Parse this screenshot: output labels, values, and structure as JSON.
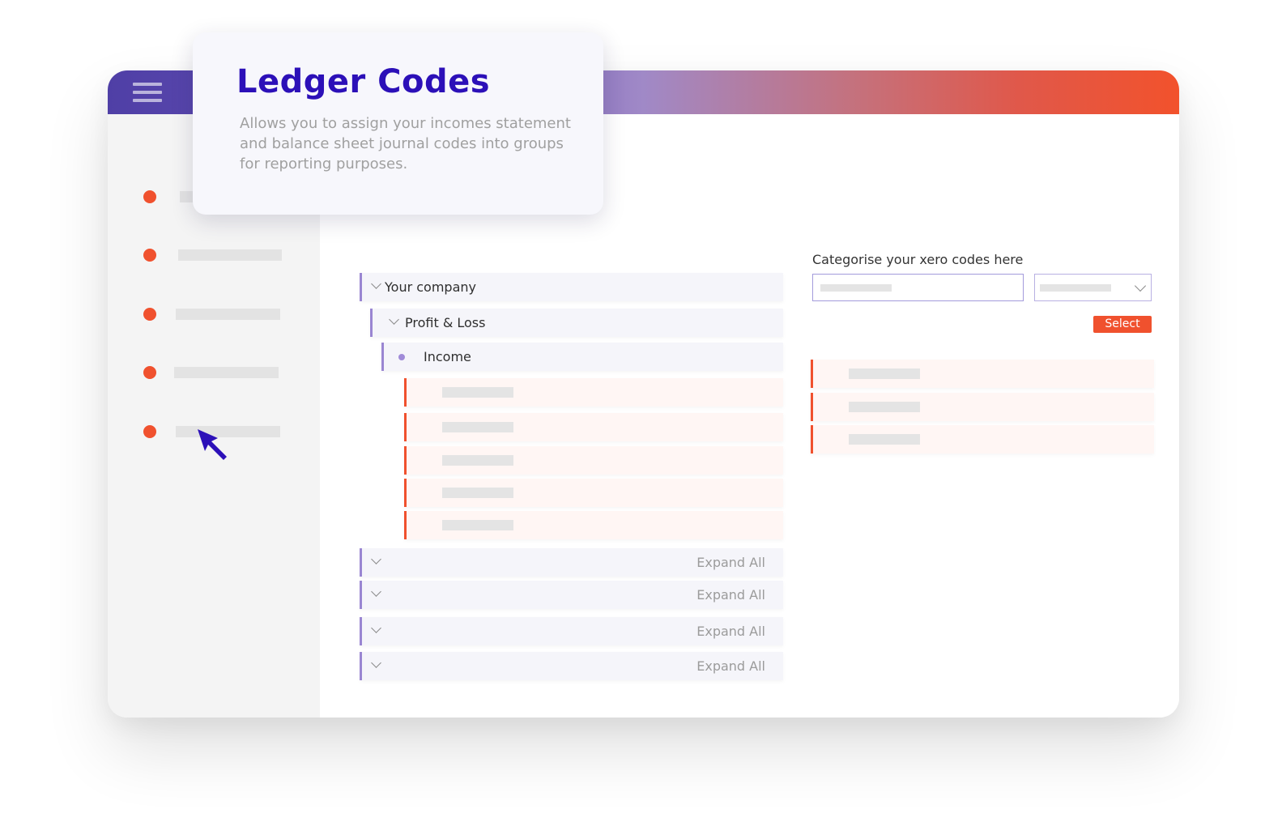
{
  "popover": {
    "title": "Ledger Codes",
    "description": "Allows you to assign your incomes statement and balance sheet journal codes into groups for reporting purposes."
  },
  "tree": {
    "root_label": "Your company",
    "child_label": "Profit & Loss",
    "leaf_label": "Income",
    "expand_all_label": "Expand All"
  },
  "categorise": {
    "title": "Categorise your xero codes here",
    "search_value": "",
    "select_button": "Select"
  },
  "icons": {
    "menu": "hamburger-menu-icon",
    "chevron": "chevron-down-icon",
    "cursor": "mouse-pointer-icon"
  },
  "colors": {
    "brand_purple": "#2c10b8",
    "accent_orange": "#f0512e",
    "tree_purple": "#9a86d2"
  }
}
